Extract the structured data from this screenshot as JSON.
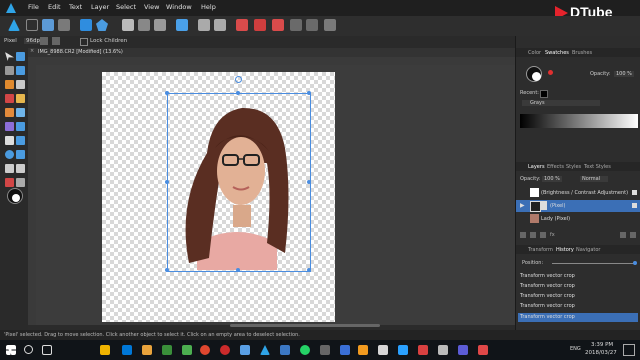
{
  "menu": {
    "items": [
      "File",
      "Edit",
      "Text",
      "Layer",
      "Select",
      "View",
      "Window",
      "Help"
    ]
  },
  "context_bar": {
    "mode": "Pixel",
    "dpi": "96dpi",
    "lock_children": "Lock Children"
  },
  "document": {
    "tab_title": "IMG_8988.CR2 [Modified] (13.6%)"
  },
  "color_panel": {
    "tabs": [
      "Color",
      "Swatches",
      "Brushes"
    ],
    "opacity_label": "Opacity:",
    "opacity_value": "100 %",
    "recent_label": "Recent:",
    "palette_select": "Grays"
  },
  "layers_panel": {
    "tabs": [
      "Layers",
      "Effects",
      "Styles",
      "Text Styles"
    ],
    "opacity_label": "Opacity:",
    "opacity_value": "100 %",
    "blend_mode": "Normal",
    "layers": [
      "(Brightness / Contrast Adjustment)",
      "(Pixel)",
      "Lady (Pixel)"
    ]
  },
  "history_panel": {
    "tabs": [
      "Transform",
      "History",
      "Navigator"
    ],
    "position_label": "Position:",
    "entries": [
      "Transform vector crop",
      "Transform vector crop",
      "Transform vector crop",
      "Transform vector crop",
      "Transform vector crop"
    ]
  },
  "status": {
    "text": "'Pixel' selected. Drag to move selection. Click another object to select it. Click on an empty area to deselect selection."
  },
  "watermark": {
    "text": "DTube"
  },
  "clock": {
    "time": "3:39 PM",
    "date": "2018/03/27",
    "lang": "ENG"
  },
  "colors": {
    "accent": "#4a8de0",
    "selected_row": "#3b6fb6",
    "dtube_red": "#e5232c"
  }
}
